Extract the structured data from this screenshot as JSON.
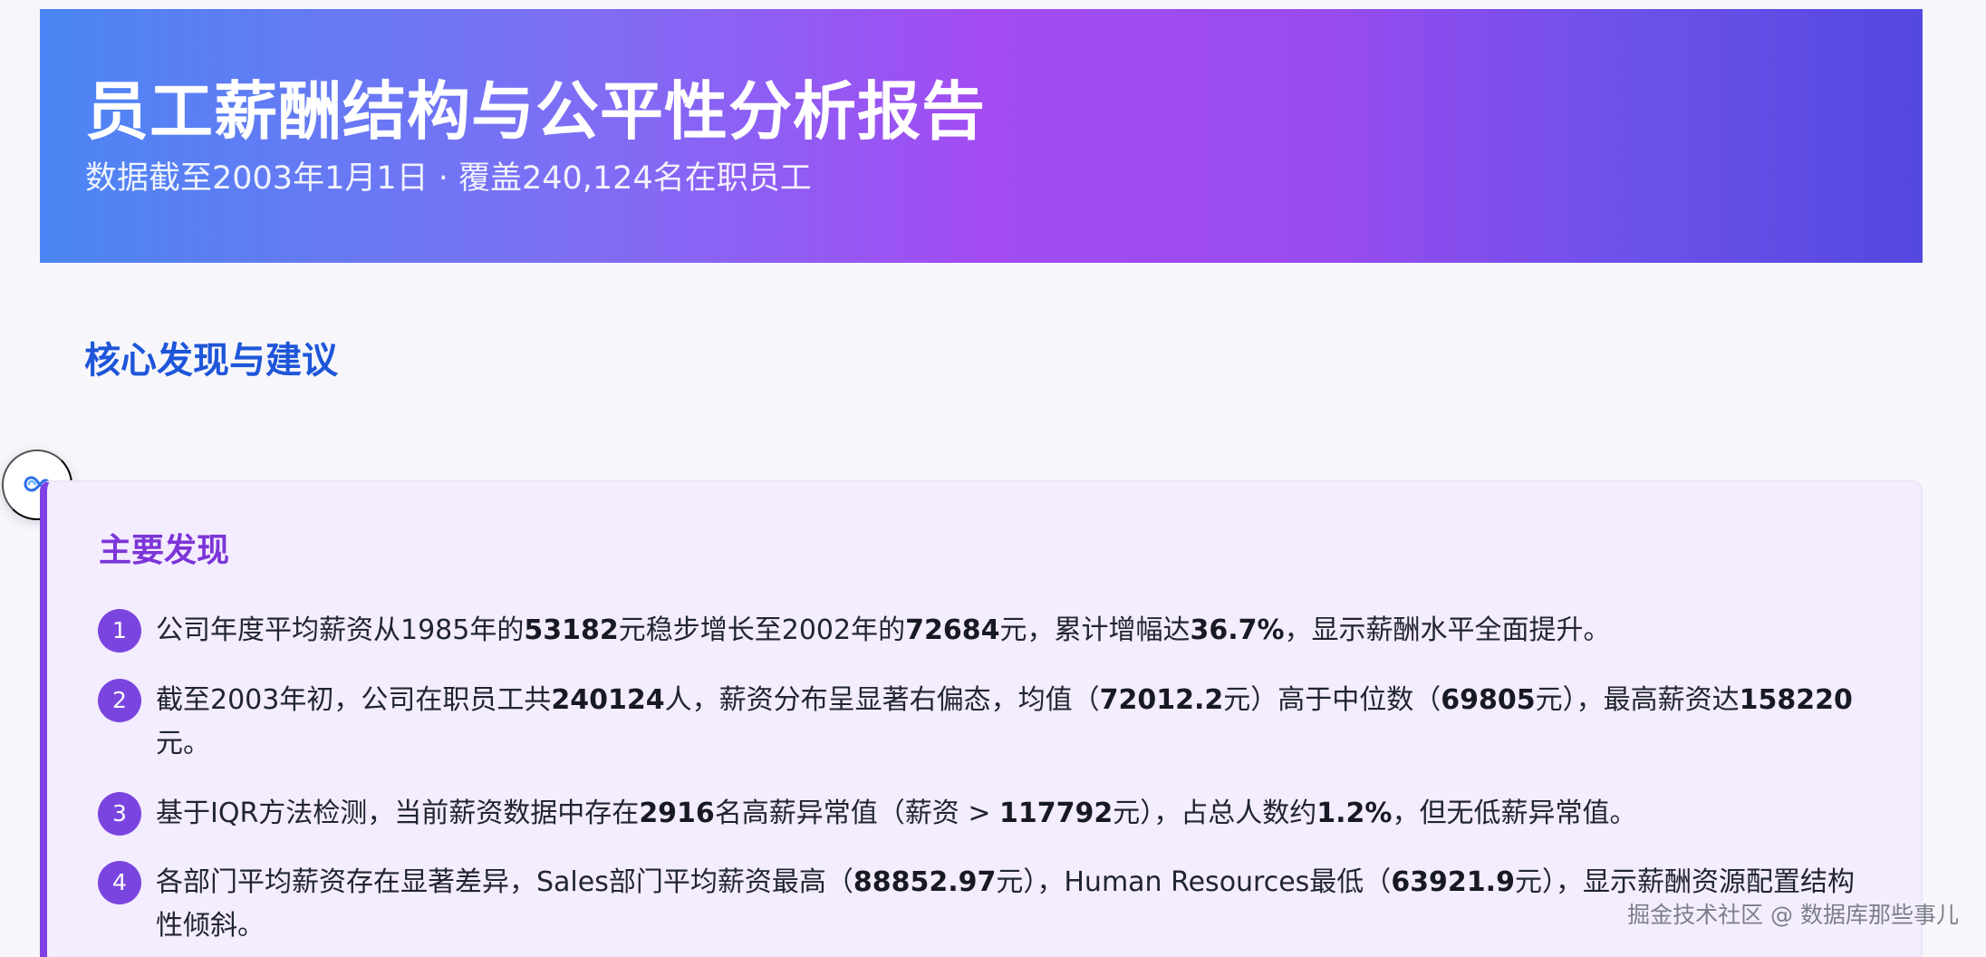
{
  "header": {
    "title": "员工薪酬结构与公平性分析报告",
    "subtitle": "数据截至2003年1月1日 · 覆盖240,124名在职员工"
  },
  "section": {
    "title": "核心发现与建议"
  },
  "floating_tool": {
    "icon": "infinity-link-icon"
  },
  "findings": {
    "title": "主要发现",
    "items": [
      {
        "number": "1",
        "parts": [
          {
            "text": "公司年度平均薪资从1985年的",
            "bold": false
          },
          {
            "text": "53182",
            "bold": true
          },
          {
            "text": "元稳步增长至2002年的",
            "bold": false
          },
          {
            "text": "72684",
            "bold": true
          },
          {
            "text": "元，累计增幅达",
            "bold": false
          },
          {
            "text": "36.7%",
            "bold": true
          },
          {
            "text": "，显示薪酬水平全面提升。",
            "bold": false
          }
        ]
      },
      {
        "number": "2",
        "parts": [
          {
            "text": "截至2003年初，公司在职员工共",
            "bold": false
          },
          {
            "text": "240124",
            "bold": true
          },
          {
            "text": "人，薪资分布呈显著右偏态，均值（",
            "bold": false
          },
          {
            "text": "72012.2",
            "bold": true
          },
          {
            "text": "元）高于中位数（",
            "bold": false
          },
          {
            "text": "69805",
            "bold": true
          },
          {
            "text": "元），最高薪资达",
            "bold": false
          },
          {
            "text": "158220",
            "bold": true
          },
          {
            "text": "元。",
            "bold": false
          }
        ]
      },
      {
        "number": "3",
        "parts": [
          {
            "text": "基于IQR方法检测，当前薪资数据中存在",
            "bold": false
          },
          {
            "text": "2916",
            "bold": true
          },
          {
            "text": "名高薪异常值（薪资 > ",
            "bold": false
          },
          {
            "text": "117792",
            "bold": true
          },
          {
            "text": "元），占总人数约",
            "bold": false
          },
          {
            "text": "1.2%",
            "bold": true
          },
          {
            "text": "，但无低薪异常值。",
            "bold": false
          }
        ]
      },
      {
        "number": "4",
        "parts": [
          {
            "text": "各部门平均薪资存在显著差异，Sales部门平均薪资最高（",
            "bold": false
          },
          {
            "text": "88852.97",
            "bold": true
          },
          {
            "text": "元），Human Resources最低（",
            "bold": false
          },
          {
            "text": "63921.9",
            "bold": true
          },
          {
            "text": "元），显示薪酬资源配置结构性倾斜。",
            "bold": false
          }
        ]
      }
    ]
  },
  "watermark": "掘金技术社区 @ 数据库那些事儿",
  "colors": {
    "header_gradient_start": "#4b86f4",
    "header_gradient_middle": "#a24cf2",
    "header_gradient_end": "#5448df",
    "section_title": "#1e56d9",
    "card_accent": "#7e40e3",
    "card_background": "#f4ecff"
  }
}
